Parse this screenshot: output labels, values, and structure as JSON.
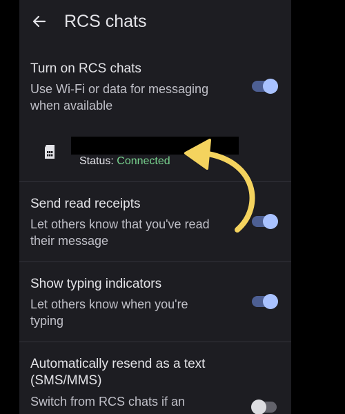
{
  "header": {
    "title": "RCS chats"
  },
  "rcs_toggle": {
    "title": "Turn on RCS chats",
    "subtitle_line1": "Use Wi-Fi or data for messaging",
    "subtitle_line2": "when available",
    "enabled": true
  },
  "sim": {
    "status_label": "Status:",
    "status_value": "Connected"
  },
  "read_receipts": {
    "title": "Send read receipts",
    "subtitle_line1": "Let others know that you've read",
    "subtitle_line2": "their message",
    "enabled": true
  },
  "typing_indicators": {
    "title": "Show typing indicators",
    "subtitle_line1": "Let others know when you're",
    "subtitle_line2": "typing",
    "enabled": true
  },
  "auto_resend": {
    "title_line1": "Automatically resend as a text",
    "title_line2": "(SMS/MMS)",
    "subtitle_line1": "Switch from RCS chats if an",
    "enabled": false
  },
  "colors": {
    "background": "#1d1d22",
    "toggle_on": "#a9c2ff",
    "status_connected": "#79d38f",
    "annotation_arrow": "#f4d35e"
  },
  "icons": {
    "back": "arrow-left-icon",
    "sim": "sim-card-icon"
  }
}
